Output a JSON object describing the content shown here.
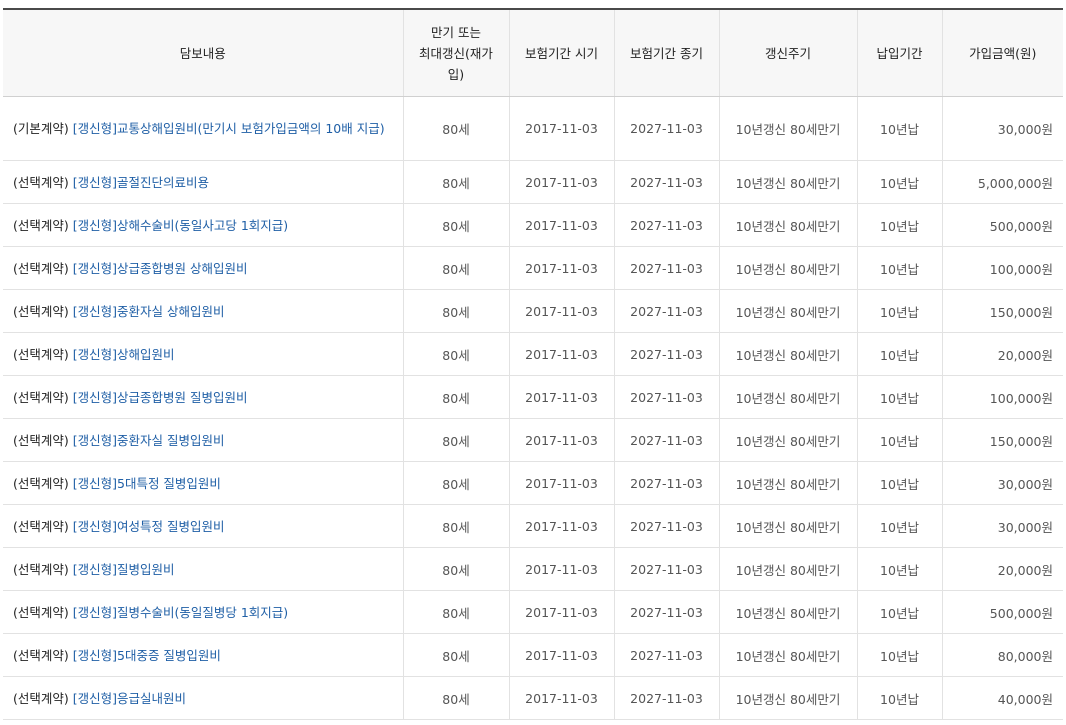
{
  "table": {
    "headers": {
      "coverage": "담보내용",
      "maturity": "만기 또는\n최대갱신(재가\n입)",
      "start": "보험기간 시기",
      "end": "보험기간 종기",
      "renewal": "갱신주기",
      "payment": "납입기간",
      "amount": "가입금액(원)"
    },
    "rows": [
      {
        "type": "(기본계약)",
        "name": "[갱신형]교통상해입원비(만기시 보험가입금액의 10배 지급)",
        "maturity": "80세",
        "start": "2017-11-03",
        "end": "2027-11-03",
        "renewal": "10년갱신 80세만기",
        "payment": "10년납",
        "amount": "30,000원"
      },
      {
        "type": "(선택계약)",
        "name": "[갱신형]골절진단의료비용",
        "maturity": "80세",
        "start": "2017-11-03",
        "end": "2027-11-03",
        "renewal": "10년갱신 80세만기",
        "payment": "10년납",
        "amount": "5,000,000원"
      },
      {
        "type": "(선택계약)",
        "name": "[갱신형]상해수술비(동일사고당 1회지급)",
        "maturity": "80세",
        "start": "2017-11-03",
        "end": "2027-11-03",
        "renewal": "10년갱신 80세만기",
        "payment": "10년납",
        "amount": "500,000원"
      },
      {
        "type": "(선택계약)",
        "name": "[갱신형]상급종합병원 상해입원비",
        "maturity": "80세",
        "start": "2017-11-03",
        "end": "2027-11-03",
        "renewal": "10년갱신 80세만기",
        "payment": "10년납",
        "amount": "100,000원"
      },
      {
        "type": "(선택계약)",
        "name": "[갱신형]중환자실 상해입원비",
        "maturity": "80세",
        "start": "2017-11-03",
        "end": "2027-11-03",
        "renewal": "10년갱신 80세만기",
        "payment": "10년납",
        "amount": "150,000원"
      },
      {
        "type": "(선택계약)",
        "name": "[갱신형]상해입원비",
        "maturity": "80세",
        "start": "2017-11-03",
        "end": "2027-11-03",
        "renewal": "10년갱신 80세만기",
        "payment": "10년납",
        "amount": "20,000원"
      },
      {
        "type": "(선택계약)",
        "name": "[갱신형]상급종합병원 질병입원비",
        "maturity": "80세",
        "start": "2017-11-03",
        "end": "2027-11-03",
        "renewal": "10년갱신 80세만기",
        "payment": "10년납",
        "amount": "100,000원"
      },
      {
        "type": "(선택계약)",
        "name": "[갱신형]중환자실 질병입원비",
        "maturity": "80세",
        "start": "2017-11-03",
        "end": "2027-11-03",
        "renewal": "10년갱신 80세만기",
        "payment": "10년납",
        "amount": "150,000원"
      },
      {
        "type": "(선택계약)",
        "name": "[갱신형]5대특정 질병입원비",
        "maturity": "80세",
        "start": "2017-11-03",
        "end": "2027-11-03",
        "renewal": "10년갱신 80세만기",
        "payment": "10년납",
        "amount": "30,000원"
      },
      {
        "type": "(선택계약)",
        "name": "[갱신형]여성특정 질병입원비",
        "maturity": "80세",
        "start": "2017-11-03",
        "end": "2027-11-03",
        "renewal": "10년갱신 80세만기",
        "payment": "10년납",
        "amount": "30,000원"
      },
      {
        "type": "(선택계약)",
        "name": "[갱신형]질병입원비",
        "maturity": "80세",
        "start": "2017-11-03",
        "end": "2027-11-03",
        "renewal": "10년갱신 80세만기",
        "payment": "10년납",
        "amount": "20,000원"
      },
      {
        "type": "(선택계약)",
        "name": "[갱신형]질병수술비(동일질병당 1회지급)",
        "maturity": "80세",
        "start": "2017-11-03",
        "end": "2027-11-03",
        "renewal": "10년갱신 80세만기",
        "payment": "10년납",
        "amount": "500,000원"
      },
      {
        "type": "(선택계약)",
        "name": "[갱신형]5대중증 질병입원비",
        "maturity": "80세",
        "start": "2017-11-03",
        "end": "2027-11-03",
        "renewal": "10년갱신 80세만기",
        "payment": "10년납",
        "amount": "80,000원"
      },
      {
        "type": "(선택계약)",
        "name": "[갱신형]응급실내원비",
        "maturity": "80세",
        "start": "2017-11-03",
        "end": "2027-11-03",
        "renewal": "10년갱신 80세만기",
        "payment": "10년납",
        "amount": "40,000원"
      }
    ]
  }
}
